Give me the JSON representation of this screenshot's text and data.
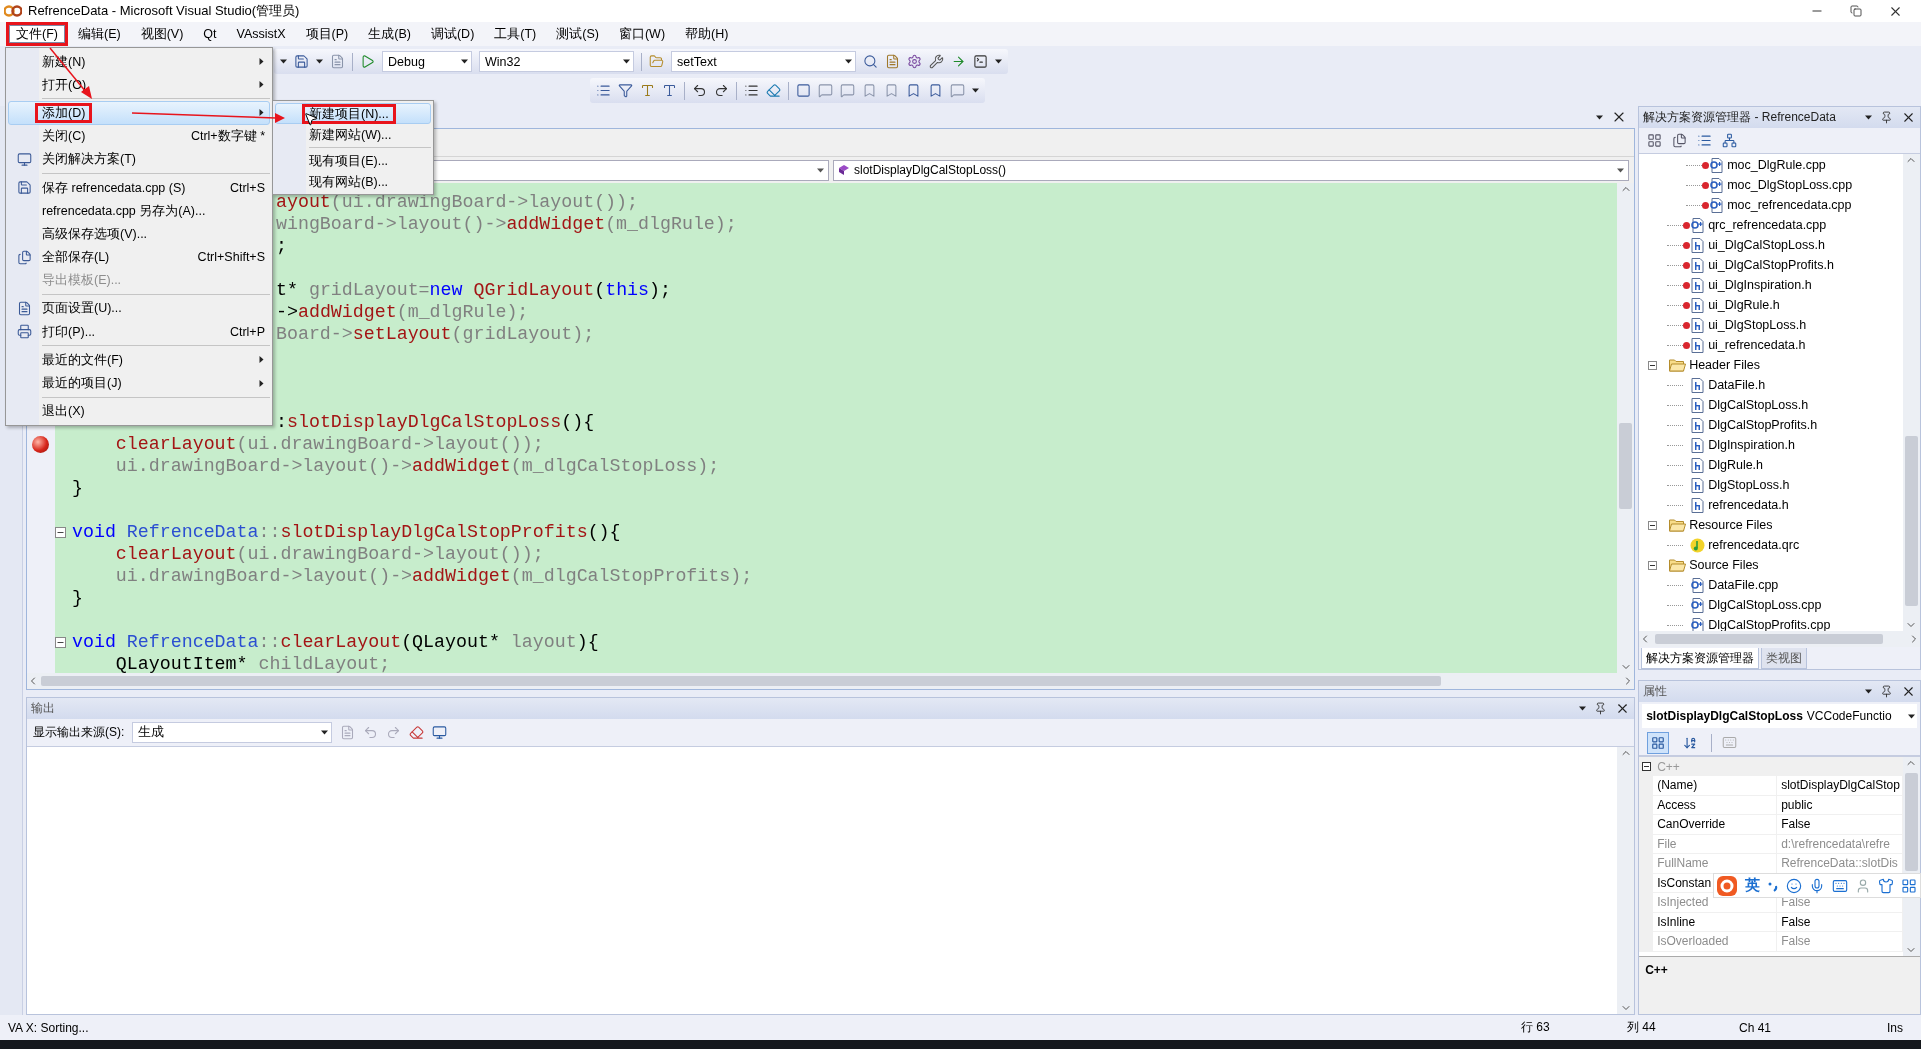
{
  "window": {
    "title": "RefrenceData - Microsoft Visual Studio(管理员)"
  },
  "menu_bar": [
    {
      "label": "文件(F)",
      "selected": true,
      "annotated": true
    },
    {
      "label": "编辑(E)",
      "selected": false,
      "annotated": false
    },
    {
      "label": "视图(V)",
      "selected": false,
      "annotated": false
    },
    {
      "label": "Qt",
      "selected": false,
      "annotated": false
    },
    {
      "label": "VAssistX",
      "selected": false,
      "annotated": false
    },
    {
      "label": "项目(P)",
      "selected": false,
      "annotated": false
    },
    {
      "label": "生成(B)",
      "selected": false,
      "annotated": false
    },
    {
      "label": "调试(D)",
      "selected": false,
      "annotated": false
    },
    {
      "label": "工具(T)",
      "selected": false,
      "annotated": false
    },
    {
      "label": "测试(S)",
      "selected": false,
      "annotated": false
    },
    {
      "label": "窗口(W)",
      "selected": false,
      "annotated": false
    },
    {
      "label": "帮助(H)",
      "selected": false,
      "annotated": false
    }
  ],
  "file_menu": [
    {
      "kind": "item",
      "label": "新建(N)",
      "submenu": true,
      "disabled": false,
      "selected": false,
      "annotated": false
    },
    {
      "kind": "item",
      "label": "打开(O)",
      "submenu": true,
      "disabled": false,
      "selected": false,
      "annotated": false
    },
    {
      "kind": "separator"
    },
    {
      "kind": "item",
      "label": "添加(D)",
      "submenu": true,
      "disabled": false,
      "selected": true,
      "annotated": true
    },
    {
      "kind": "item",
      "label": "关闭(C)",
      "shortcut": "Ctrl+数字键 *",
      "disabled": false,
      "selected": false,
      "annotated": false
    },
    {
      "kind": "item",
      "label": "关闭解决方案(T)",
      "disabled": false,
      "selected": false,
      "annotated": false
    },
    {
      "kind": "separator"
    },
    {
      "kind": "item",
      "label": "保存 refrencedata.cpp (S)",
      "shortcut": "Ctrl+S",
      "disabled": false,
      "selected": false,
      "annotated": false
    },
    {
      "kind": "item",
      "label": "refrencedata.cpp 另存为(A)...",
      "disabled": false,
      "selected": false,
      "annotated": false
    },
    {
      "kind": "item",
      "label": "高级保存选项(V)...",
      "disabled": false,
      "selected": false,
      "annotated": false
    },
    {
      "kind": "item",
      "label": "全部保存(L)",
      "shortcut": "Ctrl+Shift+S",
      "disabled": false,
      "selected": false,
      "annotated": false
    },
    {
      "kind": "item",
      "label": "导出模板(E)...",
      "disabled": true,
      "selected": false,
      "annotated": false
    },
    {
      "kind": "separator"
    },
    {
      "kind": "item",
      "label": "页面设置(U)...",
      "disabled": false,
      "selected": false,
      "annotated": false
    },
    {
      "kind": "item",
      "label": "打印(P)...",
      "shortcut": "Ctrl+P",
      "disabled": false,
      "selected": false,
      "annotated": false
    },
    {
      "kind": "separator"
    },
    {
      "kind": "item",
      "label": "最近的文件(F)",
      "submenu": true,
      "disabled": false,
      "selected": false,
      "annotated": false
    },
    {
      "kind": "item",
      "label": "最近的项目(J)",
      "submenu": true,
      "disabled": false,
      "selected": false,
      "annotated": false
    },
    {
      "kind": "separator"
    },
    {
      "kind": "item",
      "label": "退出(X)",
      "disabled": false,
      "selected": false,
      "annotated": false
    }
  ],
  "add_submenu": [
    {
      "kind": "item",
      "label": "新建项目(N)...",
      "selected": true,
      "annotated": true
    },
    {
      "kind": "item",
      "label": "新建网站(W)...",
      "selected": false,
      "annotated": false
    },
    {
      "kind": "separator"
    },
    {
      "kind": "item",
      "label": "现有项目(E)...",
      "selected": false,
      "annotated": false
    },
    {
      "kind": "item",
      "label": "现有网站(B)...",
      "selected": false,
      "annotated": false
    }
  ],
  "toolbar": {
    "configuration": "Debug",
    "platform": "Win32",
    "find": "setText"
  },
  "editor": {
    "member": "slotDisplayDlgCalStopLoss()",
    "code_lines": [
      {
        "kind": "partial",
        "segments": [
          {
            "kind": "function",
            "text": "ayout"
          },
          {
            "kind": "identifier",
            "text": "(ui.drawingBoard->layout());"
          }
        ]
      },
      {
        "kind": "partial",
        "segments": [
          {
            "kind": "identifier",
            "text": "wingBoard->layout()->"
          },
          {
            "kind": "function",
            "text": "addWidget"
          },
          {
            "kind": "identifier",
            "text": "(m_dlgRule);"
          }
        ]
      },
      {
        "kind": "partial",
        "segments": [
          {
            "kind": "plain",
            "text": ";"
          }
        ]
      },
      {
        "kind": "blank"
      },
      {
        "kind": "partial",
        "segments": [
          {
            "kind": "plain",
            "text": "t*"
          },
          {
            "kind": "identifier",
            "text": " gridLayout="
          },
          {
            "kind": "keyword",
            "text": "new"
          },
          {
            "kind": "function",
            "text": " QGridLayout"
          },
          {
            "kind": "plain",
            "text": "("
          },
          {
            "kind": "keyword",
            "text": "this"
          },
          {
            "kind": "plain",
            "text": ");"
          }
        ]
      },
      {
        "kind": "partial",
        "segments": [
          {
            "kind": "plain",
            "text": "->"
          },
          {
            "kind": "function",
            "text": "addWidget"
          },
          {
            "kind": "identifier",
            "text": "(m_dlgRule);"
          }
        ]
      },
      {
        "kind": "partial",
        "segments": [
          {
            "kind": "identifier",
            "text": "Board->"
          },
          {
            "kind": "function",
            "text": "setLayout"
          },
          {
            "kind": "identifier",
            "text": "(gridLayout);"
          }
        ]
      },
      {
        "kind": "blank"
      },
      {
        "kind": "blank"
      },
      {
        "kind": "blank"
      },
      {
        "kind": "partial",
        "segments": [
          {
            "kind": "plain",
            "text": ":"
          },
          {
            "kind": "function",
            "text": "slotDisplayDlgCalStopLoss"
          },
          {
            "kind": "plain",
            "text": "(){"
          }
        ]
      },
      {
        "kind": "full",
        "breakpoint": true,
        "foldable": false,
        "segments": [
          {
            "kind": "function",
            "text": "    clearLayout"
          },
          {
            "kind": "identifier",
            "text": "(ui.drawingBoard->layout());"
          }
        ]
      },
      {
        "kind": "full",
        "breakpoint": false,
        "foldable": false,
        "segments": [
          {
            "kind": "identifier",
            "text": "    ui.drawingBoard->layout()->"
          },
          {
            "kind": "function",
            "text": "addWidget"
          },
          {
            "kind": "identifier",
            "text": "(m_dlgCalStopLoss);"
          }
        ]
      },
      {
        "kind": "full",
        "breakpoint": false,
        "foldable": false,
        "segments": [
          {
            "kind": "plain",
            "text": "}"
          }
        ]
      },
      {
        "kind": "blank"
      },
      {
        "kind": "full",
        "breakpoint": false,
        "foldable": true,
        "segments": [
          {
            "kind": "keyword",
            "text": "void"
          },
          {
            "kind": "class",
            "text": " RefrenceData"
          },
          {
            "kind": "identifier",
            "text": "::"
          },
          {
            "kind": "function",
            "text": "slotDisplayDlgCalStopProfits"
          },
          {
            "kind": "plain",
            "text": "(){"
          }
        ]
      },
      {
        "kind": "full",
        "breakpoint": false,
        "foldable": false,
        "segments": [
          {
            "kind": "function",
            "text": "    clearLayout"
          },
          {
            "kind": "identifier",
            "text": "(ui.drawingBoard->layout());"
          }
        ]
      },
      {
        "kind": "full",
        "breakpoint": false,
        "foldable": false,
        "segments": [
          {
            "kind": "identifier",
            "text": "    ui.drawingBoard->layout()->"
          },
          {
            "kind": "function",
            "text": "addWidget"
          },
          {
            "kind": "identifier",
            "text": "(m_dlgCalStopProfits);"
          }
        ]
      },
      {
        "kind": "full",
        "breakpoint": false,
        "foldable": false,
        "segments": [
          {
            "kind": "plain",
            "text": "}"
          }
        ]
      },
      {
        "kind": "blank"
      },
      {
        "kind": "full",
        "breakpoint": false,
        "foldable": true,
        "segments": [
          {
            "kind": "keyword",
            "text": "void"
          },
          {
            "kind": "class",
            "text": " RefrenceData"
          },
          {
            "kind": "identifier",
            "text": "::"
          },
          {
            "kind": "function",
            "text": "clearLayout"
          },
          {
            "kind": "plain",
            "text": "(QLayout*"
          },
          {
            "kind": "identifier",
            "text": " layout"
          },
          {
            "kind": "plain",
            "text": "){"
          }
        ]
      },
      {
        "kind": "full",
        "breakpoint": false,
        "foldable": false,
        "segments": [
          {
            "kind": "plain",
            "text": "    QLayoutItem*"
          },
          {
            "kind": "identifier",
            "text": " childLayout;"
          }
        ]
      }
    ]
  },
  "output": {
    "title": "输出",
    "source_label": "显示输出来源(S):",
    "source": "生成"
  },
  "solution_explorer": {
    "title": "解决方案资源管理器 - RefrenceData",
    "tree": [
      {
        "children": [
          {
            "children": [
              {
                "label": "moc_DlgRule.cpp",
                "kind": "cpp",
                "excluded": true
              },
              {
                "label": "moc_DlgStopLoss.cpp",
                "kind": "cpp",
                "excluded": true
              },
              {
                "label": "moc_refrencedata.cpp",
                "kind": "cpp",
                "excluded": true
              }
            ]
          },
          {
            "label": "qrc_refrencedata.cpp",
            "kind": "cpp",
            "excluded": true
          },
          {
            "label": "ui_DlgCalStopLoss.h",
            "kind": "h",
            "excluded": true
          },
          {
            "label": "ui_DlgCalStopProfits.h",
            "kind": "h",
            "excluded": true
          },
          {
            "label": "ui_DlgInspiration.h",
            "kind": "h",
            "excluded": true
          },
          {
            "label": "ui_DlgRule.h",
            "kind": "h",
            "excluded": true
          },
          {
            "label": "ui_DlgStopLoss.h",
            "kind": "h",
            "excluded": true
          },
          {
            "label": "ui_refrencedata.h",
            "kind": "h",
            "excluded": true
          }
        ]
      },
      {
        "label": "Header Files",
        "kind": "folder",
        "expanded": true,
        "children": [
          {
            "label": "DataFile.h",
            "kind": "h",
            "excluded": false
          },
          {
            "label": "DlgCalStopLoss.h",
            "kind": "h",
            "excluded": false
          },
          {
            "label": "DlgCalStopProfits.h",
            "kind": "h",
            "excluded": false
          },
          {
            "label": "DlgInspiration.h",
            "kind": "h",
            "excluded": false
          },
          {
            "label": "DlgRule.h",
            "kind": "h",
            "excluded": false
          },
          {
            "label": "DlgStopLoss.h",
            "kind": "h",
            "excluded": false
          },
          {
            "label": "refrencedata.h",
            "kind": "h",
            "excluded": false
          }
        ]
      },
      {
        "label": "Resource Files",
        "kind": "folder",
        "expanded": true,
        "children": [
          {
            "label": "refrencedata.qrc",
            "kind": "qrc",
            "excluded": false
          }
        ]
      },
      {
        "label": "Source Files",
        "kind": "folder",
        "expanded": true,
        "children": [
          {
            "label": "DataFile.cpp",
            "kind": "cpp",
            "excluded": false
          },
          {
            "label": "DlgCalStopLoss.cpp",
            "kind": "cpp",
            "excluded": false
          },
          {
            "label": "DlgCalStopProfits.cpp",
            "kind": "cpp",
            "excluded": false
          }
        ]
      }
    ],
    "tabs": [
      {
        "label": "解决方案资源管理器",
        "selected": true
      },
      {
        "label": "类视图",
        "selected": false
      }
    ]
  },
  "properties": {
    "title": "属性",
    "object_name": "slotDisplayDlgCalStopLoss",
    "object_type": "VCCodeFunctio",
    "view_buttons": [
      {
        "selected": true
      },
      {
        "selected": false
      }
    ],
    "category": "C++",
    "rows": [
      {
        "name": "(Name)",
        "value": "slotDisplayDlgCalStop",
        "disabled": false
      },
      {
        "name": "Access",
        "value": "public",
        "disabled": false
      },
      {
        "name": "CanOverride",
        "value": "False",
        "disabled": false
      },
      {
        "name": "File",
        "value": "d:\\refrencedata\\refre",
        "disabled": true
      },
      {
        "name": "FullName",
        "value": "RefrenceData::slotDis",
        "disabled": true
      },
      {
        "name": "IsConstan",
        "disabled": false
      },
      {
        "name": "IsInjected",
        "value": "False",
        "disabled": true
      },
      {
        "name": "IsInline",
        "value": "False",
        "disabled": false
      },
      {
        "name": "IsOverloaded",
        "value": "False",
        "disabled": true
      }
    ],
    "description_title": "C++"
  },
  "ime_bar": {
    "language": "英"
  },
  "status_bar": {
    "message": "VA X: Sorting...",
    "line": "行 63",
    "column": "列 44",
    "char": "Ch 41",
    "mode": "Ins"
  }
}
